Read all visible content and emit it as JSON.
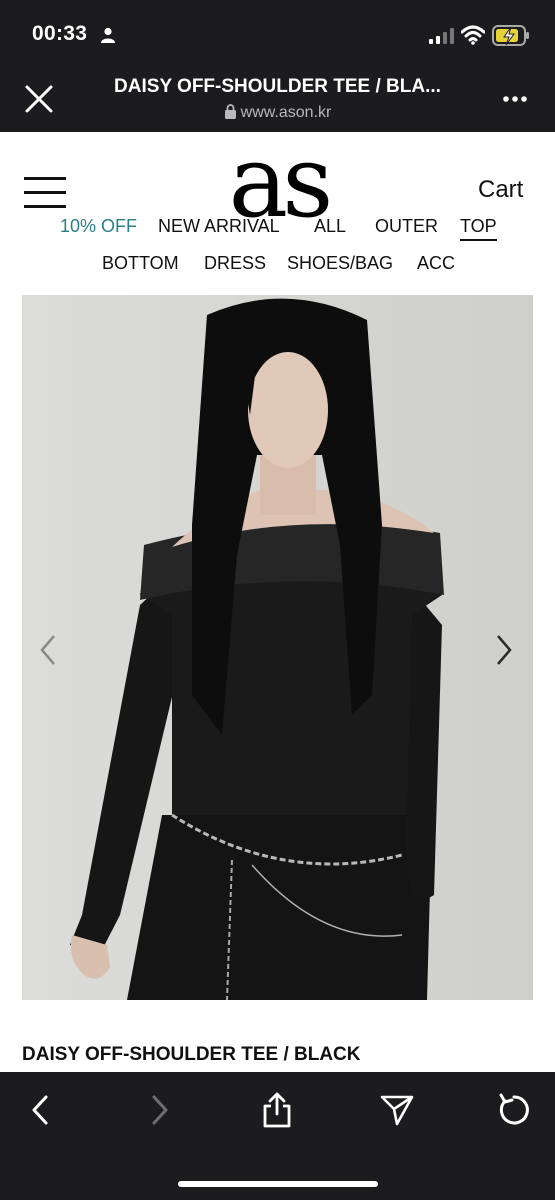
{
  "status_bar": {
    "time": "00:33"
  },
  "browser": {
    "title": "DAISY OFF-SHOULDER TEE / BLA...",
    "url": "www.ason.kr"
  },
  "site": {
    "logo_text": "as",
    "cart_label": "Cart",
    "nav_row1": [
      "10% OFF",
      "NEW ARRIVAL",
      "ALL",
      "OUTER",
      "TOP"
    ],
    "nav_row2": [
      "BOTTOM",
      "DRESS",
      "SHOES/BAG",
      "ACC"
    ],
    "active_nav": "TOP",
    "accent_color": "#2a7f8a"
  },
  "product": {
    "name": "DAISY OFF-SHOULDER TEE / BLACK"
  },
  "icons": [
    "person-icon",
    "signal-icon",
    "wifi-icon",
    "battery-charging-icon",
    "close-icon",
    "lock-icon",
    "more-icon",
    "hamburger-menu-icon",
    "chevron-left-icon",
    "chevron-right-icon",
    "back-icon",
    "forward-icon",
    "share-icon",
    "send-icon",
    "reload-icon"
  ]
}
